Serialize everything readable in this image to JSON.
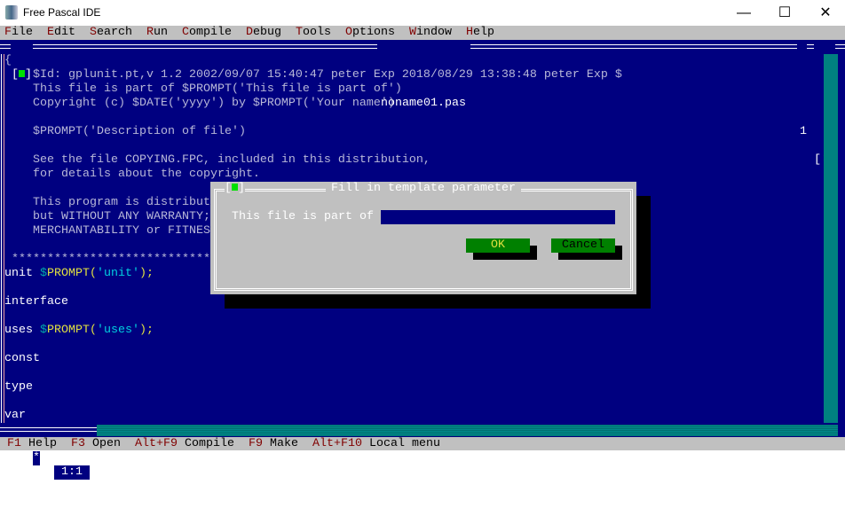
{
  "window": {
    "title": "Free Pascal IDE",
    "minimize": "—",
    "maximize": "☐",
    "close": "✕"
  },
  "menu": [
    {
      "hk": "F",
      "rest": "ile"
    },
    {
      "hk": "E",
      "rest": "dit"
    },
    {
      "hk": "S",
      "rest": "earch"
    },
    {
      "hk": "R",
      "rest": "un"
    },
    {
      "hk": "C",
      "rest": "ompile"
    },
    {
      "hk": "D",
      "rest": "ebug"
    },
    {
      "hk": "T",
      "rest": "ools"
    },
    {
      "hk": "O",
      "rest": "ptions"
    },
    {
      "hk": "W",
      "rest": "indow"
    },
    {
      "hk": "H",
      "rest": "elp"
    }
  ],
  "editor": {
    "filename": "noname01.pas",
    "window_number": "1",
    "zoom_icon": "⇕",
    "cursor_pos": "1:1",
    "modified_mark": "*",
    "lines": [
      [
        {
          "t": "{",
          "c": "cm"
        }
      ],
      [
        {
          "t": "    $Id: gplunit.pt,v 1.2 2002/09/07 15:40:47 peter Exp 2018/08/29 13:38:48 peter Exp $",
          "c": "cm"
        }
      ],
      [
        {
          "t": "    This file is part of $PROMPT('This file is part of')",
          "c": "cm"
        }
      ],
      [
        {
          "t": "    Copyright (c) $DATE('yyyy') by $PROMPT('Your name')",
          "c": "cm"
        }
      ],
      [],
      [
        {
          "t": "    $PROMPT('Description of file')",
          "c": "cm"
        }
      ],
      [],
      [
        {
          "t": "    See the file COPYING.FPC, included in this distribution,",
          "c": "cm"
        }
      ],
      [
        {
          "t": "    for details about the copyright.",
          "c": "cm"
        }
      ],
      [],
      [
        {
          "t": "    This program is distributed in the hope that it will be useful,",
          "c": "cm"
        }
      ],
      [
        {
          "t": "    but WITHOUT ANY WARRANTY; without even the implied warranty of",
          "c": "cm"
        }
      ],
      [
        {
          "t": "    MERCHANTABILITY or FITNESS FOR A PARTICULAR PURPOSE.",
          "c": "cm"
        }
      ],
      [],
      [
        {
          "t": " **********************************************************************",
          "c": "cm"
        }
      ],
      [
        {
          "t": "unit ",
          "c": "kw"
        },
        {
          "t": "$",
          "c": "dl"
        },
        {
          "t": "PROMPT(",
          "c": "fn"
        },
        {
          "t": "'unit'",
          "c": "st"
        },
        {
          "t": ");",
          "c": "fn"
        }
      ],
      [],
      [
        {
          "t": "interface",
          "c": "kw"
        }
      ],
      [],
      [
        {
          "t": "uses ",
          "c": "kw"
        },
        {
          "t": "$",
          "c": "dl"
        },
        {
          "t": "PROMPT(",
          "c": "fn"
        },
        {
          "t": "'uses'",
          "c": "st"
        },
        {
          "t": ");",
          "c": "fn"
        }
      ],
      [],
      [
        {
          "t": "const",
          "c": "kw"
        }
      ],
      [],
      [
        {
          "t": "type",
          "c": "kw"
        }
      ],
      [],
      [
        {
          "t": "var",
          "c": "kw"
        }
      ]
    ]
  },
  "dialog": {
    "title": "Fill in template parameter",
    "label": "This file is part of",
    "value": "",
    "ok": "OK",
    "cancel": "Cancel"
  },
  "status": [
    {
      "k": "F1",
      "l": " Help"
    },
    {
      "k": "F3",
      "l": " Open"
    },
    {
      "k": "Alt+F9",
      "l": " Compile"
    },
    {
      "k": "F9",
      "l": " Make"
    },
    {
      "k": "Alt+F10",
      "l": " Local menu"
    }
  ]
}
